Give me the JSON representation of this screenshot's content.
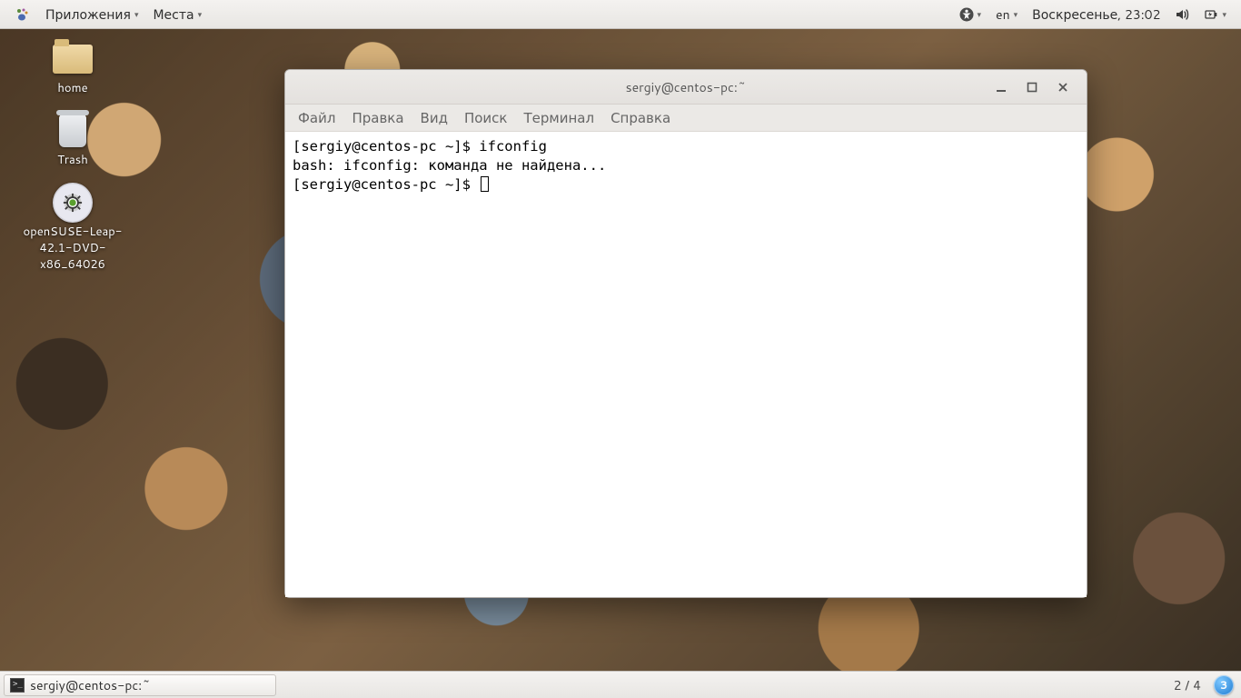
{
  "top_panel": {
    "applications": "Приложения",
    "places": "Места",
    "lang": "en",
    "clock": "Воскресенье, 23:02"
  },
  "desktop": {
    "home": "home",
    "trash": "Trash",
    "iso": "openSUSE-Leap-42.1-DVD-x86_64026"
  },
  "terminal": {
    "title": "sergiy@centos-pc:~",
    "menu": {
      "file": "Файл",
      "edit": "Правка",
      "view": "Вид",
      "search": "Поиск",
      "terminal": "Терминал",
      "help": "Справка"
    },
    "lines": {
      "l1": "[sergiy@centos-pc ~]$ ifconfig",
      "l2": "bash: ifconfig: команда не найдена...",
      "l3": "[sergiy@centos-pc ~]$ "
    }
  },
  "bottom_panel": {
    "task": "sergiy@centos-pc:~",
    "workspace_text": "2 / 4",
    "workspace_badge": "3"
  }
}
